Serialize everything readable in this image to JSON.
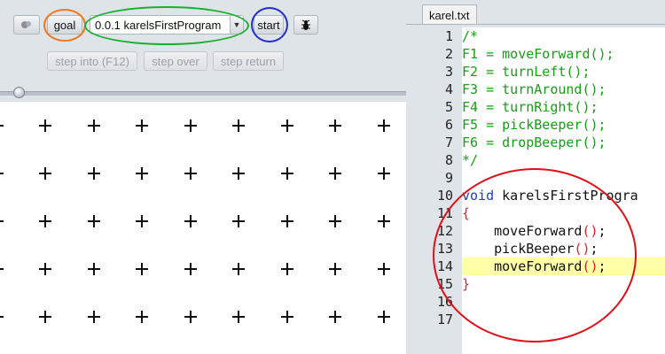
{
  "toolbar": {
    "goal_label": "goal",
    "program_select_value": "0.0.1 karelsFirstProgram",
    "start_label": "start",
    "step_into_label": "step into (F12)",
    "step_over_label": "step over",
    "step_return_label": "step return"
  },
  "slider": {
    "level": 0.02
  },
  "world": {
    "rows": 5,
    "columns": 9
  },
  "editor": {
    "tab_label": "karel.txt",
    "line_numbers": [
      "1",
      "2",
      "3",
      "4",
      "5",
      "6",
      "7",
      "8",
      "9",
      "10",
      "11",
      "12",
      "13",
      "14",
      "15",
      "16",
      "17"
    ],
    "lines": [
      [
        {
          "t": "/*",
          "c": "com"
        }
      ],
      [
        {
          "t": "F1 = moveForward();",
          "c": "com"
        }
      ],
      [
        {
          "t": "F2 = turnLeft();",
          "c": "com"
        }
      ],
      [
        {
          "t": "F3 = turnAround();",
          "c": "com"
        }
      ],
      [
        {
          "t": "F4 = turnRight();",
          "c": "com"
        }
      ],
      [
        {
          "t": "F5 = pickBeeper();",
          "c": "com"
        }
      ],
      [
        {
          "t": "F6 = dropBeeper();",
          "c": "com"
        }
      ],
      [
        {
          "t": "*/",
          "c": "com"
        }
      ],
      [],
      [
        {
          "t": "void",
          "c": "kw"
        },
        {
          "t": " karelsFirstProgra",
          "c": "plain"
        }
      ],
      [
        {
          "t": "{",
          "c": "red"
        }
      ],
      [
        {
          "t": "    moveForward",
          "c": "plain"
        },
        {
          "t": "()",
          "c": "red"
        },
        {
          "t": ";",
          "c": "plain"
        }
      ],
      [
        {
          "t": "    pickBeeper",
          "c": "plain"
        },
        {
          "t": "()",
          "c": "red"
        },
        {
          "t": ";",
          "c": "plain"
        }
      ],
      [
        {
          "t": "    moveForward",
          "c": "plain"
        },
        {
          "t": "()",
          "c": "red"
        },
        {
          "t": ";",
          "c": "plain"
        }
      ],
      [
        {
          "t": "}",
          "c": "red"
        }
      ],
      [],
      []
    ],
    "highlighted_line": 14
  },
  "annotation_colors": {
    "goal": "#f07820",
    "program_select": "#18b030",
    "start": "#2030c8",
    "code": "#e0101a"
  }
}
